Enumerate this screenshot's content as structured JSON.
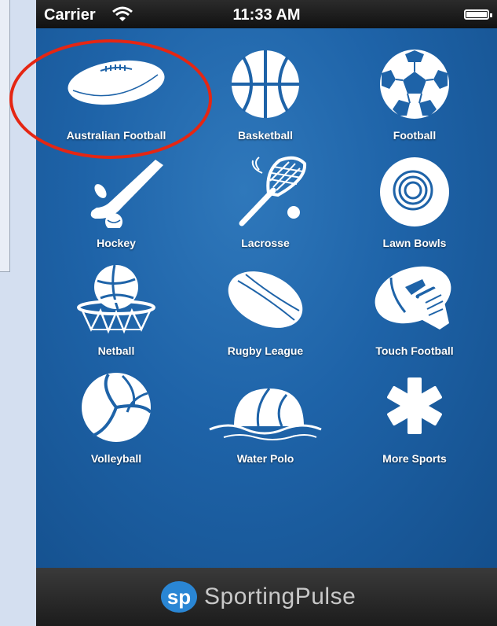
{
  "status_bar": {
    "carrier": "Carrier",
    "time": "11:33 AM"
  },
  "sports": [
    {
      "label": "Australian Football",
      "icon": "australian-football-icon"
    },
    {
      "label": "Basketball",
      "icon": "basketball-icon"
    },
    {
      "label": "Football",
      "icon": "soccer-ball-icon"
    },
    {
      "label": "Hockey",
      "icon": "hockey-stick-icon"
    },
    {
      "label": "Lacrosse",
      "icon": "lacrosse-stick-icon"
    },
    {
      "label": "Lawn Bowls",
      "icon": "lawn-bowl-icon"
    },
    {
      "label": "Netball",
      "icon": "netball-icon"
    },
    {
      "label": "Rugby League",
      "icon": "rugby-ball-icon"
    },
    {
      "label": "Touch Football",
      "icon": "touch-football-icon"
    },
    {
      "label": "Volleyball",
      "icon": "volleyball-icon"
    },
    {
      "label": "Water Polo",
      "icon": "water-polo-icon"
    },
    {
      "label": "More Sports",
      "icon": "asterisk-icon"
    }
  ],
  "footer": {
    "logo_text": "sp",
    "brand": "SportingPulse"
  },
  "colors": {
    "background": "#1e63a8",
    "highlight": "#e52613",
    "footer": "#1c1c1c"
  }
}
